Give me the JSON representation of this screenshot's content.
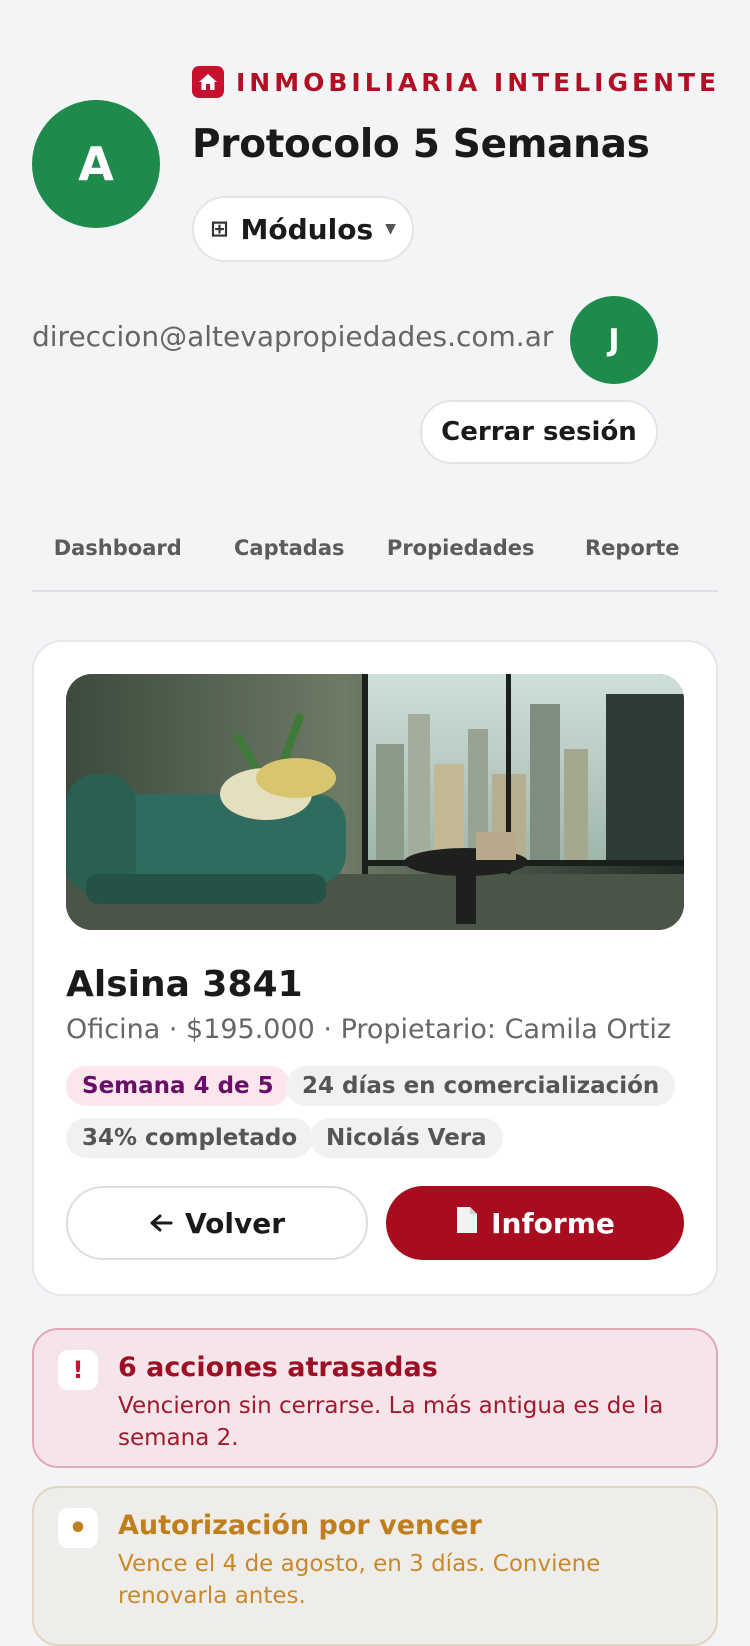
{
  "header": {
    "brand_name": "INMOBILIARIA INTELIGENTE",
    "avatar_letter": "A",
    "title": "Protocolo 5 Semanas",
    "modules_label": "Módulos",
    "user_email": "direccion@altevapropiedades.com.ar",
    "user_initial": "J",
    "logout_label": "Cerrar sesión"
  },
  "tabs": [
    {
      "label": "Dashboard"
    },
    {
      "label": "Captadas"
    },
    {
      "label": "Propiedades"
    },
    {
      "label": "Reporte"
    }
  ],
  "property": {
    "name": "Alsina 3841",
    "summary": "Oficina · $195.000 · Propietario: Camila Ortiz",
    "week_chip": "Semana 4 de 5",
    "days_chip": "24 días en comercialización",
    "progress_chip": "34% completado",
    "agent_chip": "Nicolás Vera",
    "back_label": "Volver",
    "report_label": "Informe"
  },
  "alerts": [
    {
      "icon": "!",
      "title": "6 acciones atrasadas",
      "text": "Vencieron sin cerrarse. La más antigua es de la semana 2."
    },
    {
      "icon": "•",
      "title": "Autorización por vencer",
      "text": "Vence el 4 de agosto, en 3 días. Conviene renovarla antes."
    }
  ],
  "colors": {
    "brand_red": "#c8102e",
    "report_button": "#a80d1f",
    "avatar_green": "#1e8a4c",
    "alert_red_bg": "#f5e5ea",
    "alert_amber_text": "#c07f1f"
  }
}
